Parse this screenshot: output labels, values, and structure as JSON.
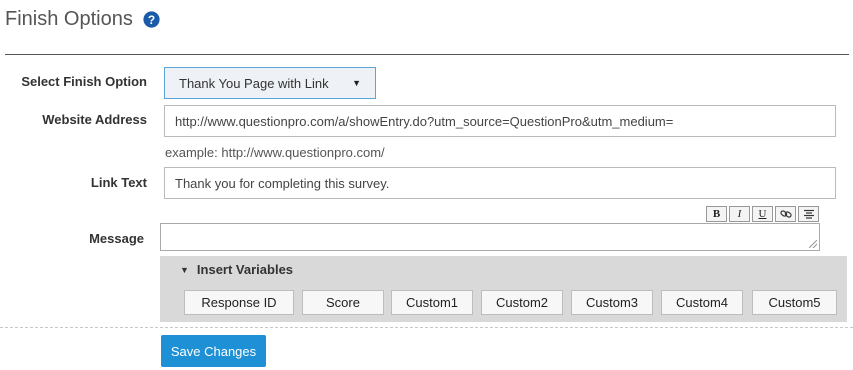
{
  "page": {
    "title": "Finish Options"
  },
  "labels": {
    "finish_option": "Select Finish Option",
    "website_address": "Website Address",
    "link_text": "Link Text",
    "message": "Message"
  },
  "finish_option": {
    "selected": "Thank You Page with Link"
  },
  "website_address": {
    "value": "http://www.questionpro.com/a/showEntry.do?utm_source=QuestionPro&utm_medium=",
    "example": "example: http://www.questionpro.com/"
  },
  "link_text": {
    "value": "Thank you for completing this survey."
  },
  "editor_toolbar": {
    "bold": "B",
    "italic": "I",
    "underline": "U",
    "link": "🔗",
    "align": "≡"
  },
  "insert_variables": {
    "header": "Insert Variables",
    "buttons": [
      "Response ID",
      "Score",
      "Custom1",
      "Custom2",
      "Custom3",
      "Custom4",
      "Custom5"
    ]
  },
  "actions": {
    "save": "Save Changes"
  },
  "colors": {
    "accent": "#1e90d6",
    "help_icon": "#1a5aa8",
    "panel_bg": "#d9d9d9"
  }
}
